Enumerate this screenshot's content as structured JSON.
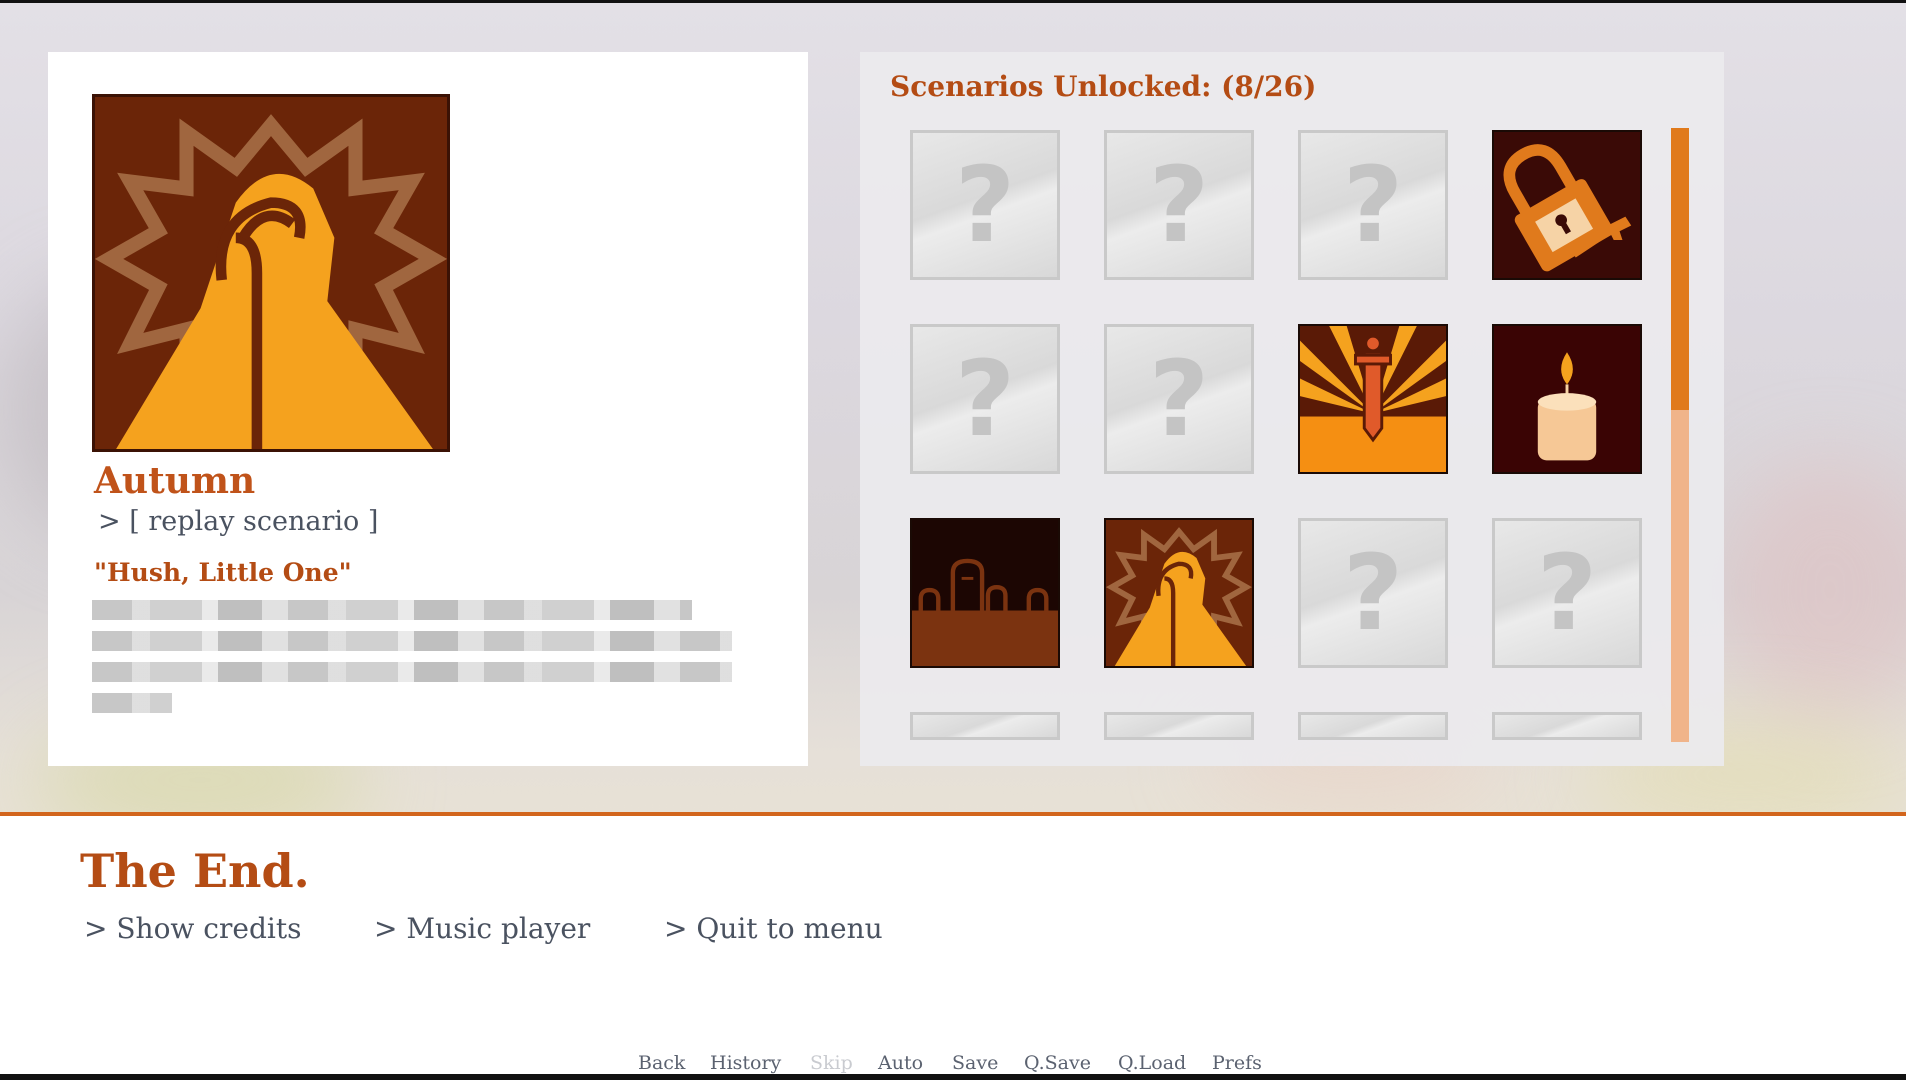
{
  "character": {
    "name": "Autumn",
    "replay_label": "> [ replay scenario ]",
    "quote": "\"Hush, Little One\"",
    "portrait_icon": "praying-hands-icon"
  },
  "gallery": {
    "title": "Scenarios Unlocked: (8/26)",
    "unlocked_count": 8,
    "total_count": 26,
    "locked_symbol": "?",
    "tiles": [
      {
        "state": "locked"
      },
      {
        "state": "locked"
      },
      {
        "state": "locked"
      },
      {
        "state": "unlocked",
        "icon": "padlock-key-icon"
      },
      {
        "state": "locked"
      },
      {
        "state": "locked"
      },
      {
        "state": "unlocked",
        "icon": "sword-burst-icon"
      },
      {
        "state": "unlocked",
        "icon": "candle-icon"
      },
      {
        "state": "unlocked",
        "icon": "graveyard-icon"
      },
      {
        "state": "unlocked",
        "icon": "praying-hands-icon"
      },
      {
        "state": "locked"
      },
      {
        "state": "locked"
      }
    ],
    "scroll_fraction": 0.46
  },
  "ending": {
    "title": "The End.",
    "links": [
      "> Show credits",
      "> Music player",
      "> Quit to menu"
    ]
  },
  "quick_menu": {
    "back": "Back",
    "history": "History",
    "skip": "Skip",
    "auto": "Auto",
    "save": "Save",
    "qsave": "Q.Save",
    "qload": "Q.Load",
    "prefs": "Prefs"
  },
  "colors": {
    "accent": "#b44c14",
    "divider": "#d2651c",
    "scroll_thumb": "#e07a1c",
    "scroll_track": "#f0b48a",
    "link_text": "#4a5260"
  }
}
